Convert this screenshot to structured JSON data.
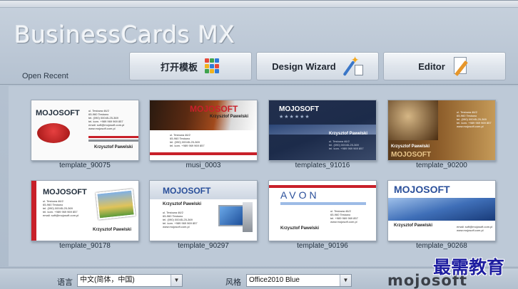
{
  "app": {
    "title": "BusinessCards MX"
  },
  "toolbar": {
    "open_recent": "Open Recent",
    "open_template_label": "打开模板",
    "design_wizard_label": "Design Wizard",
    "editor_label": "Editor"
  },
  "templates": [
    {
      "label": "template_90075",
      "logo": "MOJOSOFT",
      "person": "Krzysztof Pawelski"
    },
    {
      "label": "musi_0003",
      "logo": "MOJOSOFT",
      "person": "Krzysztof Pawelski"
    },
    {
      "label": "templates_91016",
      "logo": "MOJOSOFT",
      "person": "Krzysztof Pawelski"
    },
    {
      "label": "template_90200",
      "logo": "MOJOSOFT",
      "person": "Krzysztof Pawelski"
    },
    {
      "label": "template_90178",
      "logo": "MOJOSOFT",
      "person": "Krzysztof Pawelski"
    },
    {
      "label": "template_90297",
      "logo": "MOJOSOFT",
      "person": "Krzysztof Pawelski"
    },
    {
      "label": "template_90196",
      "logo": "AVON",
      "person": "Krzysztof Pawelski"
    },
    {
      "label": "template_90268",
      "logo": "MOJOSOFT",
      "person": "Krzysztof Pawelski"
    }
  ],
  "bottom": {
    "language_label": "语言",
    "language_value": "中文(简体，中国)",
    "style_label": "风格",
    "style_value": "Office2010 Blue",
    "brand": "mojosoft"
  },
  "watermark": "最需教育",
  "colors": {
    "accent_red": "#c8202a",
    "dark_blue": "#1c2b4a",
    "avon_blue": "#2a4f9a"
  }
}
